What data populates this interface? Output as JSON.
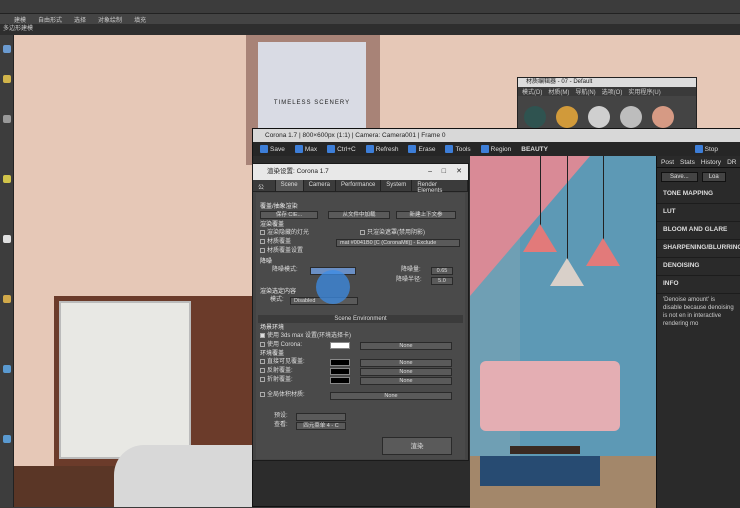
{
  "ribbon": {
    "items": [
      "建模",
      "自由形式",
      "选择",
      "对象绘制",
      "填充"
    ]
  },
  "viewport": {
    "label": "多边形建模"
  },
  "artwork": {
    "caption": "TIMELESS SCENERY"
  },
  "material_editor": {
    "title": "材质编辑器 - 07 - Default",
    "menu": [
      "模式(D)",
      "材质(M)",
      "导航(N)",
      "选项(O)",
      "实用程序(U)"
    ]
  },
  "vfb": {
    "title": "Corona 1.7 | 800×600px (1:1) | Camera: Camera001 | Frame 0",
    "toolbar": [
      "Save",
      "Max",
      "Ctrl+C",
      "Refresh",
      "Erase",
      "Tools",
      "Region",
      "BEAUTY"
    ],
    "stop_label": "Stop",
    "side_tabs": [
      "Post",
      "Stats",
      "History",
      "DR"
    ],
    "side_buttons": [
      "Save...",
      "Loa"
    ],
    "sections": [
      "TONE MAPPING",
      "LUT",
      "BLOOM AND GLARE",
      "SHARPENING/BLURRING",
      "DENOISING",
      "INFO"
    ],
    "info_text": "'Denoise amount' is disable because denoising is not en in interactive rendering mo"
  },
  "render_setup": {
    "title": "渲染设置: Corona 1.7",
    "tabs": [
      "公用",
      "Scene",
      "Camera",
      "Performance",
      "System",
      "Render Elements"
    ],
    "sections": {
      "override": "覆盖/抽象渲染",
      "override_btns": [
        "保存 CIE...",
        "从文件中加载",
        "新建上下文参"
      ],
      "scene_override": "渲染覆盖",
      "hide_lights": "渲染隐藏的灯光",
      "render_override": "只渲染遮罩(禁用阴影)",
      "material_override": "材质覆盖",
      "mat_value": "mat #0041B0 [C (CoronaMtl)] - Exclude",
      "override_text": "材质覆盖设置",
      "denoise": "降噪",
      "denoise_mode_label": "降噪模式:",
      "denoise_amount_label": "降噪量:",
      "denoise_amount": "0.65",
      "denoise_radius_label": "降噪半径:",
      "denoise_radius": "5.0",
      "render_select": "渲染选定内容",
      "mode_label": "模式:",
      "mode_value": "Disabled",
      "scene_env": "Scene Environment",
      "env_group": "场景环境",
      "use_max": "使用 3ds max 设置(环境选择卡)",
      "use_corona": "使用 Corona:",
      "none": "None",
      "env_override": "环境覆盖",
      "direct_vis": "直接可见覆盖:",
      "reflect": "反射覆盖:",
      "refract": "折射覆盖:",
      "global_volume": "全局体积材质:",
      "preset_label": "预设:",
      "view_label": "查看:",
      "view_value": "四元菜单 4 - C",
      "render_btn": "渲染"
    }
  }
}
